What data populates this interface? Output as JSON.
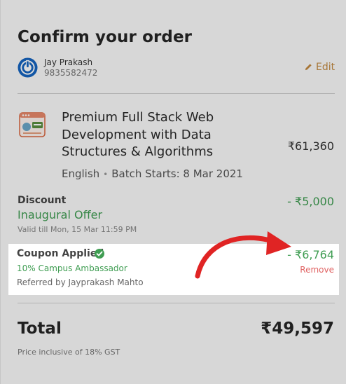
{
  "order": {
    "title": "Confirm your order"
  },
  "user": {
    "name": "Jay Prakash",
    "phone": "9835582472",
    "edit_label": "Edit"
  },
  "course": {
    "title": "Premium Full Stack Web Development with Data Structures & Algorithms",
    "language": "English",
    "separator": "•",
    "batch": "Batch Starts: 8 Mar 2021",
    "price": "₹61,360"
  },
  "discount": {
    "label": "Discount",
    "name": "Inaugural Offer",
    "valid_till": "Valid till Mon, 15 Mar 11:59 PM",
    "amount": "- ₹5,000"
  },
  "coupon": {
    "label": "Coupon Applied",
    "name": "10% Campus Ambassador",
    "referred_by": "Referred by Jayprakash Mahto",
    "amount": "- ₹6,764",
    "remove_label": "Remove"
  },
  "total": {
    "label": "Total",
    "amount": "₹49,597",
    "note": "Price inclusive of 18% GST"
  },
  "colors": {
    "accent_green": "#3f9d52",
    "edit_orange": "#c38a40",
    "remove_red": "#e06363",
    "arrow_red": "#e02424",
    "avatar_blue": "#1565c0"
  },
  "icons": {
    "avatar": "power-icon",
    "edit": "pencil-icon",
    "course": "course-thumbnail-icon",
    "coupon": "check-circle-icon",
    "annotation": "curved-arrow-icon"
  }
}
